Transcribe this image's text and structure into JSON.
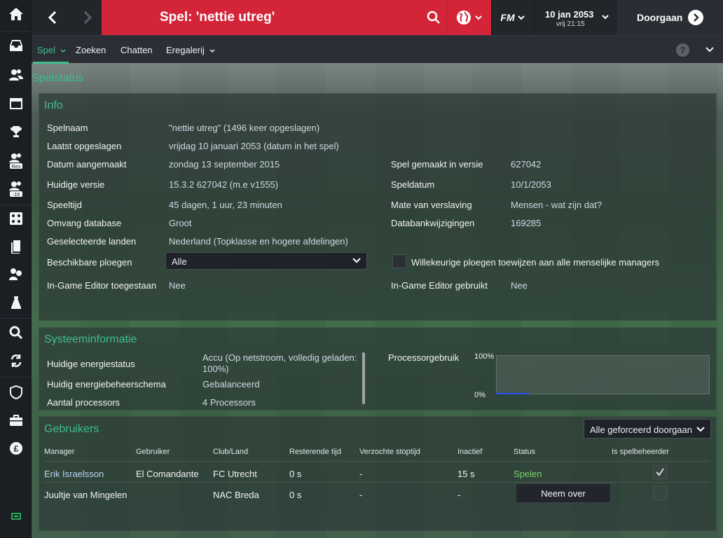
{
  "topbar": {
    "title": "Spel: 'nettie utreg'",
    "fm_label": "FM",
    "date": "10 jan 2053",
    "date_sub": "vrij 21:15",
    "continue_label": "Doorgaan",
    "accent_color": "#d42538"
  },
  "sidebar": {
    "badges": {
      "reserves": "Res",
      "u19": "-19"
    }
  },
  "subnav": {
    "items": [
      {
        "label": "Spel"
      },
      {
        "label": "Zoeken"
      },
      {
        "label": "Chatten"
      },
      {
        "label": "Eregalerij"
      }
    ],
    "help": "?"
  },
  "page": {
    "section_title": "Spelstatus"
  },
  "info": {
    "title": "Info",
    "save_name_label": "Spelnaam",
    "save_name_value": "\"nettie utreg\" (1496 keer opgeslagen)",
    "last_saved_label": "Laatst opgeslagen",
    "last_saved_value": "vrijdag 10 januari 2053 (datum in het spel)",
    "created_label": "Datum aangemaakt",
    "created_value": "zondag 13 september 2015",
    "current_version_label": "Huidige versie",
    "current_version_value": "15.3.2 627042 (m.e v1555)",
    "playtime_label": "Speeltijd",
    "playtime_value": "45 dagen, 1 uur, 23 minuten",
    "db_size_label": "Omvang database",
    "db_size_value": "Groot",
    "countries_label": "Geselecteerde landen",
    "countries_value": "Nederland (Topklasse en hogere afdelingen)",
    "teams_label": "Beschikbare ploegen",
    "teams_value": "Alle",
    "editor_allowed_label": "In-Game Editor toegestaan",
    "editor_allowed_value": "Nee",
    "created_version_label": "Spel gemaakt in versie",
    "created_version_value": "627042",
    "game_date_label": "Speldatum",
    "game_date_value": "10/1/2053",
    "addiction_label": "Mate van verslaving",
    "addiction_value": "Mensen - wat zijn dat?",
    "db_changes_label": "Databankwijzigingen",
    "db_changes_value": "169285",
    "random_teams_label": "Willekeurige ploegen toewijzen aan alle menselijke managers",
    "editor_used_label": "In-Game Editor gebruikt",
    "editor_used_value": "Nee"
  },
  "system": {
    "title": "Systeeminformatie",
    "power_status_label": "Huidige energiestatus",
    "power_status_line1": "Accu (Op netstroom, volledig geladen:",
    "power_status_line2": "100%)",
    "power_scheme_label": "Huidig energiebeheerschema",
    "power_scheme_value": "Gebalanceerd",
    "processors_label": "Aantal processors",
    "processors_value": "4 Processors",
    "cpu_usage_label": "Processorgebruik",
    "cpu_max": "100%",
    "cpu_min": "0%"
  },
  "users": {
    "title": "Gebruikers",
    "dropdown": "Alle geforceerd doorgaan",
    "columns": [
      "Manager",
      "Gebruiker",
      "Club/Land",
      "Resterende tijd",
      "Verzochte stoptijd",
      "Inactief",
      "Status",
      "Is spelbeheerder"
    ],
    "rows": [
      {
        "manager": "Erik Israelsson",
        "user": "El Comandante",
        "club": "FC Utrecht",
        "remaining": "0 s",
        "requested_stop": "-",
        "inactive": "15 s",
        "status": "Spelen",
        "is_host": true
      },
      {
        "manager": "Juultje van Mingelen",
        "user": "",
        "club": "NAC Breda",
        "remaining": "0 s",
        "requested_stop": "-",
        "inactive": "-",
        "status": "Neem over",
        "is_host": false
      }
    ]
  }
}
